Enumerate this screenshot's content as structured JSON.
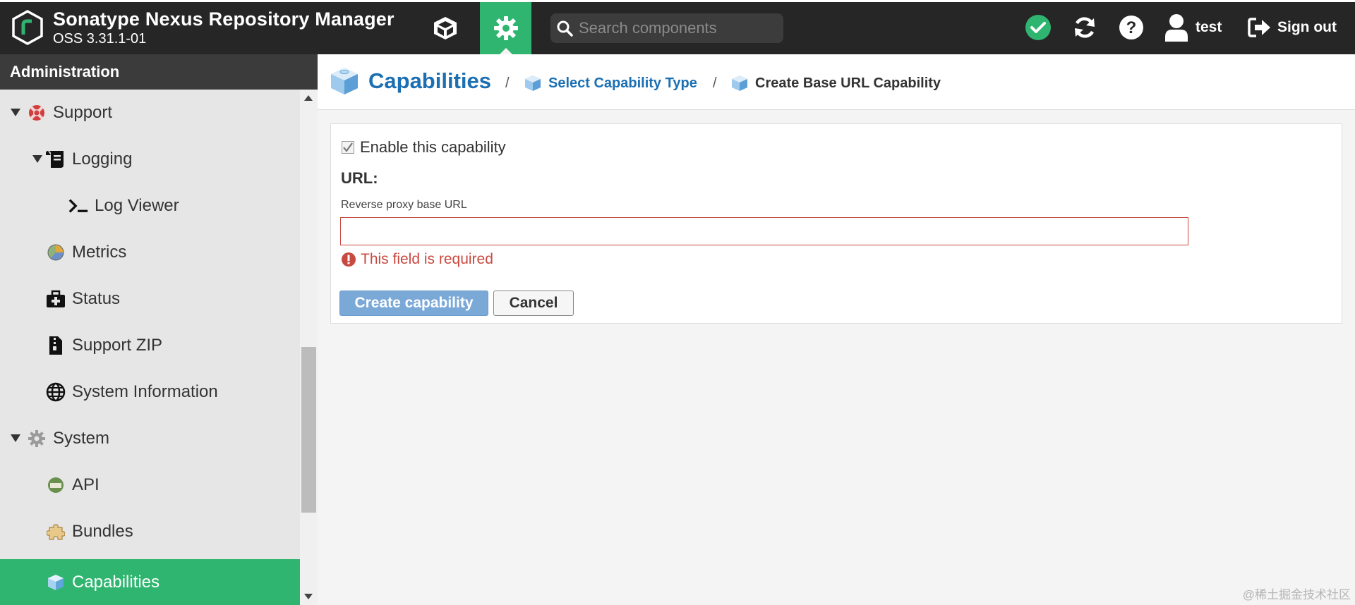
{
  "header": {
    "title": "Sonatype Nexus Repository Manager",
    "version": "OSS 3.31.1-01",
    "search_placeholder": "Search components",
    "user_name": "test",
    "sign_out_label": "Sign out"
  },
  "sidebar": {
    "title": "Administration",
    "items": [
      {
        "label": "Support",
        "icon": "support-icon",
        "expanded": true
      },
      {
        "label": "Logging",
        "icon": "logging-icon",
        "expanded": true
      },
      {
        "label": "Log Viewer",
        "icon": "terminal-icon"
      },
      {
        "label": "Metrics",
        "icon": "metrics-icon"
      },
      {
        "label": "Status",
        "icon": "medkit-icon"
      },
      {
        "label": "Support ZIP",
        "icon": "zip-file-icon"
      },
      {
        "label": "System Information",
        "icon": "globe-icon"
      },
      {
        "label": "System",
        "icon": "gear-icon",
        "expanded": true
      },
      {
        "label": "API",
        "icon": "api-icon"
      },
      {
        "label": "Bundles",
        "icon": "puzzle-icon"
      },
      {
        "label": "Capabilities",
        "icon": "cube-icon",
        "selected": true
      }
    ]
  },
  "breadcrumb": {
    "root": "Capabilities",
    "sep1": "/",
    "step1": "Select Capability Type",
    "sep2": "/",
    "current": "Create Base URL Capability"
  },
  "form": {
    "enable_label": "Enable this capability",
    "enable_checked": true,
    "section_heading": "URL:",
    "field_label": "Reverse proxy base URL",
    "field_value": "",
    "error_text": "This field is required",
    "create_label": "Create capability",
    "cancel_label": "Cancel"
  },
  "watermark": "@稀土掘金技术社区",
  "colors": {
    "header_bg": "#262626",
    "accent_green": "#2fb56f",
    "link_blue": "#1b6fb3",
    "error_red": "#c8493f",
    "button_blue": "#7aa9d8"
  }
}
